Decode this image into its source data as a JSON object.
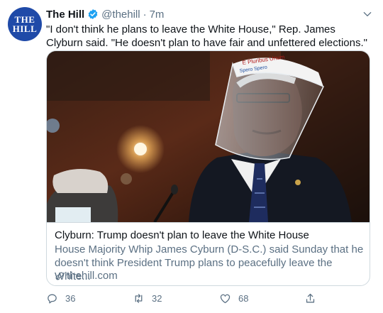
{
  "tweet": {
    "avatar_text_line1": "THE",
    "avatar_text_line2": "HILL",
    "author_name": "The Hill",
    "handle": "@thehill",
    "separator": "·",
    "time": "7m",
    "text": "\"I don't think he plans to leave the White House,\" Rep. James Clyburn said. \"He doesn't plan to have fair and unfettered elections.\""
  },
  "card": {
    "face_shield_text_1": "E Pluribus Unum",
    "face_shield_text_2": "Spero Spero",
    "title": "Clyburn: Trump doesn't plan to leave the White House",
    "description": "House Majority Whip James Cyburn (D-S.C.) said Sunday that he doesn't think President Trump plans to peacefully leave the White...",
    "domain": "thehill.com"
  },
  "actions": {
    "reply_count": "36",
    "retweet_count": "32",
    "like_count": "68"
  },
  "colors": {
    "brand": "#1f4aa8",
    "verified": "#1da1f2",
    "secondary_text": "#5b7083",
    "border": "#cfd9de"
  },
  "icons": [
    "verified-badge-icon",
    "chevron-down-icon",
    "link-icon",
    "reply-icon",
    "retweet-icon",
    "like-icon",
    "share-icon"
  ]
}
